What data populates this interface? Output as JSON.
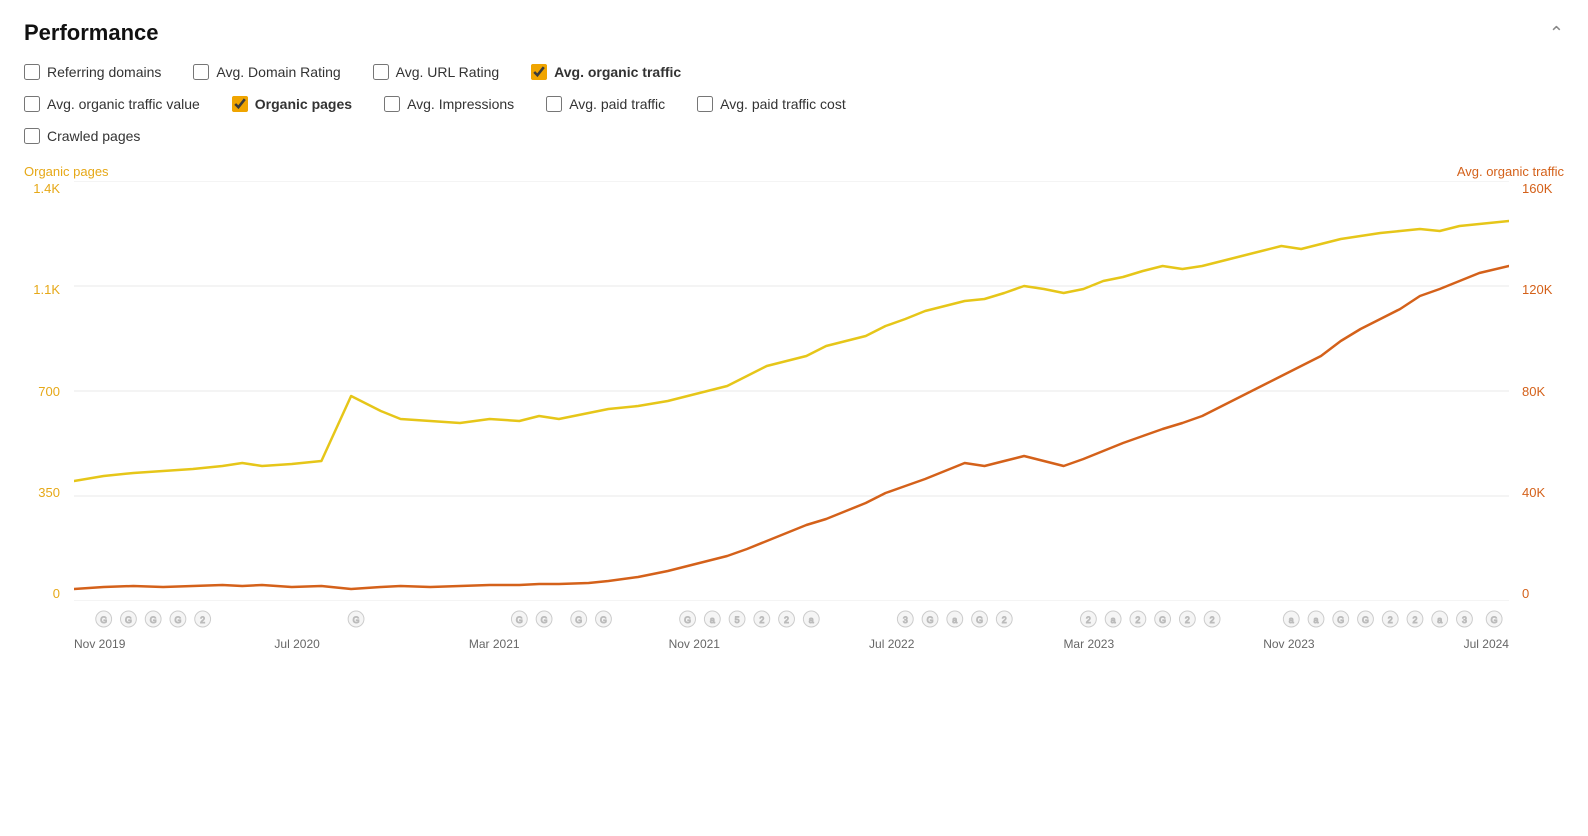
{
  "header": {
    "title": "Performance",
    "collapse_icon": "⌃"
  },
  "checkboxes": [
    {
      "id": "referring-domains",
      "label": "Referring domains",
      "checked": false,
      "bold": false
    },
    {
      "id": "avg-domain-rating",
      "label": "Avg. Domain Rating",
      "checked": false,
      "bold": false
    },
    {
      "id": "avg-url-rating",
      "label": "Avg. URL Rating",
      "checked": false,
      "bold": false
    },
    {
      "id": "avg-organic-traffic",
      "label": "Avg. organic traffic",
      "checked": true,
      "bold": true
    },
    {
      "id": "avg-organic-traffic-value",
      "label": "Avg. organic traffic value",
      "checked": false,
      "bold": false
    },
    {
      "id": "organic-pages",
      "label": "Organic pages",
      "checked": true,
      "bold": true
    },
    {
      "id": "avg-impressions",
      "label": "Avg. Impressions",
      "checked": false,
      "bold": false
    },
    {
      "id": "avg-paid-traffic",
      "label": "Avg. paid traffic",
      "checked": false,
      "bold": false
    },
    {
      "id": "avg-paid-traffic-cost",
      "label": "Avg. paid traffic cost",
      "checked": false,
      "bold": false
    },
    {
      "id": "crawled-pages",
      "label": "Crawled pages",
      "checked": false,
      "bold": false
    }
  ],
  "chart": {
    "left_axis_label": "Organic pages",
    "right_axis_label": "Avg. organic traffic",
    "left_ticks": [
      "1.4K",
      "1.1K",
      "700",
      "350",
      "0"
    ],
    "right_ticks": [
      "160K",
      "120K",
      "80K",
      "40K",
      "0"
    ],
    "x_labels": [
      "Nov 2019",
      "Jul 2020",
      "Mar 2021",
      "Nov 2021",
      "Jul 2022",
      "Mar 2023",
      "Nov 2023",
      "Jul 2024"
    ],
    "colors": {
      "organic_pages": "#e6c619",
      "avg_organic_traffic": "#d4611a",
      "grid": "#e8e8e8"
    }
  }
}
